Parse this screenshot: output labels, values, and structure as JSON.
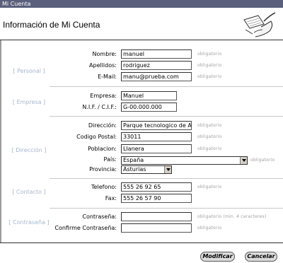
{
  "window": {
    "title": "Mi Cuenta"
  },
  "header": {
    "title": "Información de Mi Cuenta"
  },
  "sections": {
    "personal": "[ Personal ]",
    "empresa": "[ Empresa ]",
    "direccion": "[ Dirección ]",
    "contacto": "[ Contacto ]",
    "contrasena": "[ Contraseña ]"
  },
  "fields": {
    "nombre": {
      "label": "Nombre:",
      "value": "manuel",
      "hint": "obligatorio"
    },
    "apellidos": {
      "label": "Apellidos:",
      "value": "rodriguez",
      "hint": "obligatorio"
    },
    "email": {
      "label": "E-Mail:",
      "value": "manu@prueba.com",
      "hint": "obligatorio"
    },
    "empresa": {
      "label": "Empresa:",
      "value": "Manuel"
    },
    "nif": {
      "label": "N.I.F. / C.I.F.:",
      "value": "G-00.000.000"
    },
    "direccion": {
      "label": "Dirección:",
      "value": "Parque tecnologico de A",
      "hint": "obligatorio"
    },
    "codigo_postal": {
      "label": "Codigo Postal:",
      "value": "33011",
      "hint": "obligatorio"
    },
    "poblacion": {
      "label": "Poblacion:",
      "value": "Llanera",
      "hint": "obligatorio"
    },
    "pais": {
      "label": "País:",
      "value": "España",
      "hint": "obligatorio"
    },
    "provincia": {
      "label": "Provincia:",
      "value": "Asturias"
    },
    "telefono": {
      "label": "Telefono:",
      "value": "555 26 92 65",
      "hint": "obligatorio"
    },
    "fax": {
      "label": "Fax:",
      "value": "555 26 57 90"
    },
    "contrasena": {
      "label": "Contraseña:",
      "value": "",
      "hint": "obligatorio (min. 4 caracteres)"
    },
    "confirme": {
      "label": "Confirme Contraseña:",
      "value": "",
      "hint": "obligatorio"
    }
  },
  "buttons": {
    "modificar": "Modificar",
    "cancelar": "Cancelar"
  }
}
